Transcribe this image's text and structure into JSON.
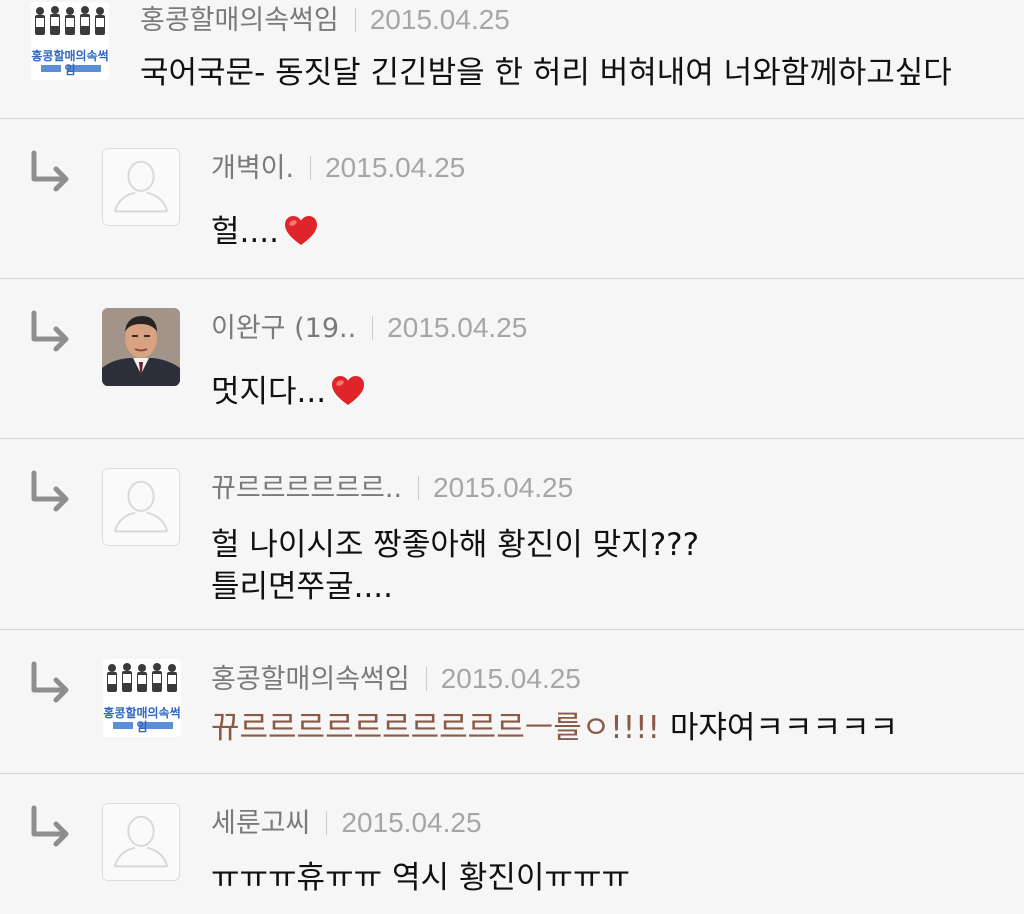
{
  "comments": [
    {
      "author": "홍콩할매의속썩임",
      "date": "2015.04.25",
      "text": "국어국문- 동짓달 긴긴밤을 한 허리 버혀내여 너와함께하고싶다",
      "avatar": "group-photo-avatar",
      "reply": false
    },
    {
      "author": "개벽이.",
      "date": "2015.04.25",
      "text": "헐....",
      "emoji": "heart",
      "avatar": "default-person-avatar",
      "reply": true
    },
    {
      "author": "이완구 (19..",
      "date": "2015.04.25",
      "text": "멋지다...",
      "emoji": "heart",
      "avatar": "man-in-suit-photo-avatar",
      "reply": true
    },
    {
      "author": "뀨르르르르르르..",
      "date": "2015.04.25",
      "text_line1": "헐 나이시조 짱좋아해 황진이 맞지???",
      "text_line2": "틀리면쭈굴....",
      "avatar": "default-person-avatar",
      "reply": true
    },
    {
      "author": "홍콩할매의속썩임",
      "date": "2015.04.25",
      "text_highlight": "뀨르르르르르르르르르르ㅡ를ㅇ!!!!",
      "text": " 마쟈여ㅋㅋㅋㅋㅋ",
      "highlight_color": "#8a5a48",
      "avatar": "group-photo-avatar",
      "reply": true
    },
    {
      "author": "세룬고씨",
      "date": "2015.04.25",
      "text": "ㅠㅠㅠ휴ㅠㅠ 역시 황진이ㅠㅠㅠ",
      "avatar": "default-person-avatar",
      "reply": true
    }
  ],
  "logo_text": "홍콩할매의속썩임"
}
